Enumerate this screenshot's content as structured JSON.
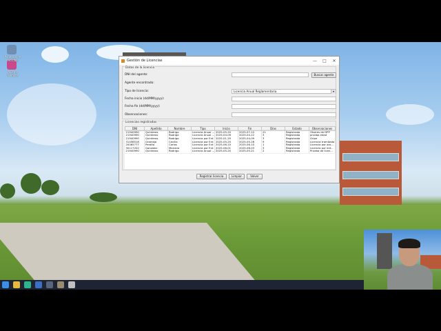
{
  "desktop": {
    "icons": [
      {
        "label": "Papelera de reciclaje",
        "icon": "recycle-bin-icon",
        "color": "#6f8fb2"
      },
      {
        "label": "Ajustes Políticos",
        "icon": "app-icon",
        "color": "#c94a8c"
      }
    ]
  },
  "window": {
    "title": "Gestión de Licencias",
    "controls": [
      "—",
      "□",
      "✕"
    ]
  },
  "form": {
    "section_title": "Datos de la licencia",
    "dni_label": "DNI del agente:",
    "dni_value": "",
    "buscar_button": "Buscar agente",
    "agente_label": "Agente encontrado:",
    "tipo_label": "Tipo de licencia:",
    "tipo_value": "Licencia Anual Reglamentaria",
    "fecha_inicio_label": "Fecha inicio (dd/MM/yyyy):",
    "fecha_inicio_value": "",
    "fecha_fin_label": "Fecha fin (dd/MM/yyyy):",
    "fecha_fin_value": "",
    "observaciones_label": "Observaciones:",
    "observaciones_value": ""
  },
  "table": {
    "section_title": "Licencias registradas",
    "columns": [
      "DNI",
      "Apellido",
      "Nombre",
      "Tipo",
      "Inicio",
      "Fin",
      "Días",
      "Estado",
      "Observaciones"
    ],
    "rows": [
      [
        "21940990",
        "Quinteros",
        "Rodrigo",
        "Licencia Anual ...",
        "2025-05-20",
        "2025-07-10",
        "21",
        "Registrada",
        "Otorres de DPP"
      ],
      [
        "21940990",
        "Quinteros",
        "Rodrigo",
        "Licencia Anual ...",
        "2025-04-09",
        "2025-04-12",
        "3",
        "Registrada",
        "prueba edad"
      ],
      [
        "21940990",
        "Quinteros",
        "Rodrigo",
        "Licencia por Enf.",
        "2025-01-20",
        "2025-04-09",
        "3",
        "Registrada",
        "Gripe"
      ],
      [
        "31458518",
        "Gramajo",
        "Cecilia",
        "Licencia por Enf.",
        "2025-05-20",
        "2025-05-28",
        "9",
        "Registrada",
        "Licencia tramitada"
      ],
      [
        "20065777",
        "Peralta",
        "Carlos",
        "Licencia por Enf.",
        "2025-06-10",
        "2025-06-10",
        "1",
        "Registrada",
        "Licencia por ass..."
      ],
      [
        "30117202",
        "Gonzalez",
        "Mariana",
        "Licencia por Enf.",
        "2025-06-01",
        "2025-06-03",
        "3",
        "Registrada",
        "Licencia por enf..."
      ],
      [
        "21940990",
        "Quinteros",
        "Rodrigo",
        "Licencia Anual ...",
        "2025-05-20",
        "2025-05-21",
        "2",
        "Registrada",
        "Prueba de licen..."
      ]
    ]
  },
  "buttons": {
    "registrar": "Registrar licencia",
    "limpiar": "Limpiar",
    "volver": "Volver"
  },
  "taskbar": {
    "items": [
      {
        "icon": "windows-start-icon",
        "color": "#3a8ee6"
      },
      {
        "icon": "file-explorer-icon",
        "color": "#e7b83e"
      },
      {
        "icon": "edge-browser-icon",
        "color": "#2fb58c"
      },
      {
        "icon": "word-icon",
        "color": "#3b6fc2"
      },
      {
        "icon": "terminal-icon",
        "color": "#55657a"
      },
      {
        "icon": "java-app-icon",
        "color": "#9a8a70"
      },
      {
        "icon": "java-app-icon-2",
        "color": "#c0c0c0"
      }
    ]
  }
}
